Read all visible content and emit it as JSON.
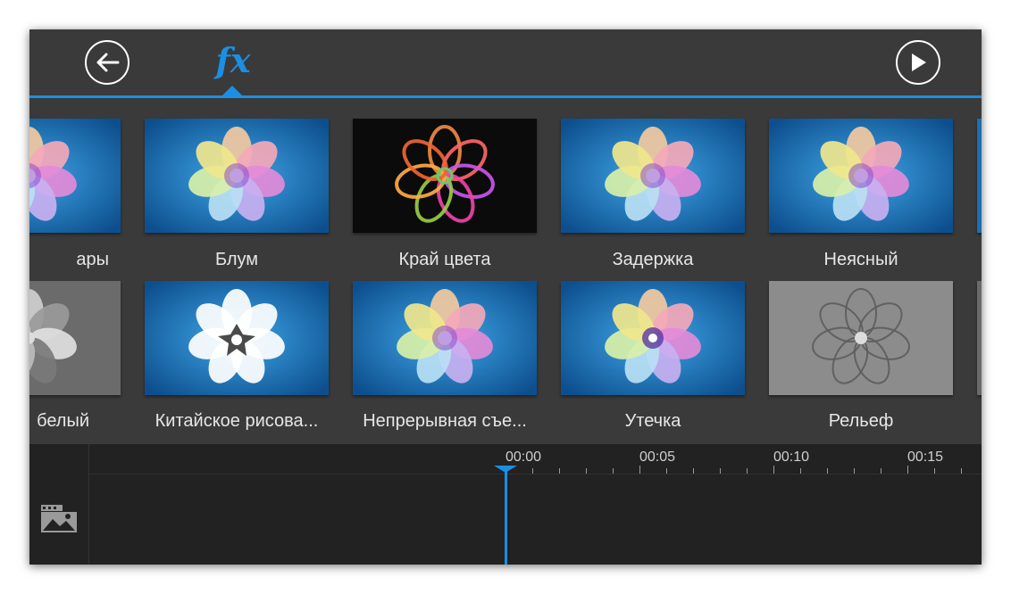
{
  "header": {
    "back_icon": "arrow-left-icon",
    "fx_tab_label": "fx",
    "play_icon": "play-icon",
    "accent_color": "#1a8fe3"
  },
  "effects_row1": [
    {
      "label": "ары",
      "style": "flower-soft"
    },
    {
      "label": "Блум",
      "style": "flower-bloom"
    },
    {
      "label": "Край цвета",
      "style": "flower-outline"
    },
    {
      "label": "Задержка",
      "style": "flower-soft"
    },
    {
      "label": "Неясный",
      "style": "flower-blur"
    }
  ],
  "effects_row2": [
    {
      "label": "белый",
      "style": "flower-gray"
    },
    {
      "label": "Китайское рисова...",
      "style": "flower-white"
    },
    {
      "label": "Непрерывная съе...",
      "style": "flower-soft"
    },
    {
      "label": "Утечка",
      "style": "flower-swirl"
    },
    {
      "label": "Рельеф",
      "style": "flower-emboss"
    }
  ],
  "timeline": {
    "time_labels": [
      "00:00",
      "00:05",
      "00:10",
      "00:15"
    ],
    "playhead_time": "00:00",
    "track_icon": "image-clip-icon"
  }
}
